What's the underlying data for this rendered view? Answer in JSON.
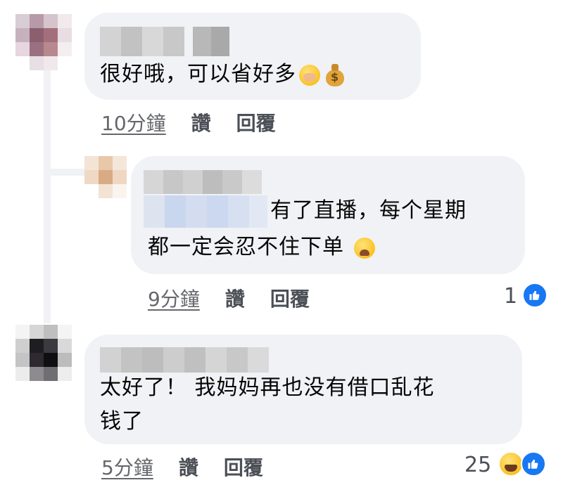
{
  "comments": [
    {
      "text": "很好哦，可以省好多",
      "time": "10分鐘",
      "like_label": "讚",
      "reply_label": "回覆",
      "emoji": [
        "hand-over-mouth-emoji",
        "money-bag-emoji"
      ]
    },
    {
      "text_line1": "有了直播，每个星期",
      "text_line2": "都一定会忍不住下单",
      "time": "9分鐘",
      "like_label": "讚",
      "reply_label": "回覆",
      "emoji": [
        "weary-face-emoji"
      ],
      "reaction_count": "1",
      "reactions": [
        "like-reaction-icon"
      ]
    },
    {
      "text_line1": "太好了！ 我妈妈再也没有借口乱花",
      "text_line2": "钱了",
      "time": "5分鐘",
      "like_label": "讚",
      "reply_label": "回覆",
      "reaction_count": "25",
      "reactions": [
        "haha-reaction-icon",
        "like-reaction-icon"
      ]
    }
  ],
  "colors": {
    "bubble": "#f0f2f5",
    "meta_text": "#65676b",
    "like_blue": "#1877f2"
  }
}
